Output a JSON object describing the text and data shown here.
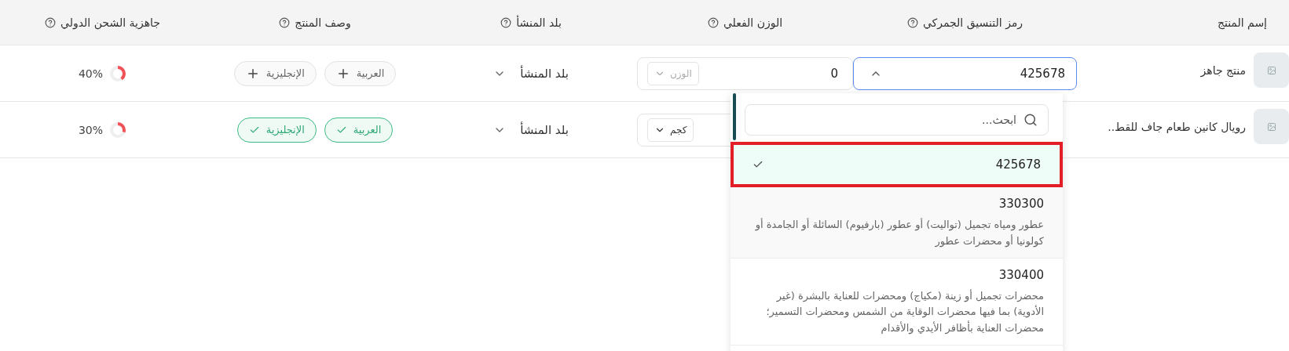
{
  "table": {
    "columns": [
      {
        "label": "إسم المنتج",
        "help": false
      },
      {
        "label": "رمز التنسيق الجمركي",
        "help": true
      },
      {
        "label": "الوزن الفعلي",
        "help": true
      },
      {
        "label": "بلد المنشأ",
        "help": true
      },
      {
        "label": "وصف المنتج",
        "help": true
      },
      {
        "label": "جاهزية الشحن الدولي",
        "help": true
      }
    ],
    "rows": [
      {
        "name": "منتج جاهز",
        "hs_code": {
          "value": "425678",
          "open": true
        },
        "weight": {
          "value": "0",
          "unit_placeholder": "الوزن"
        },
        "origin": "بلد المنشأ",
        "descriptions": [
          {
            "label": "العربية",
            "done": false
          },
          {
            "label": "الإنجليزية",
            "done": false
          }
        ],
        "readiness": {
          "level": 0.4,
          "reading": "40%"
        }
      },
      {
        "name": "رويال كانين طعام جاف للقط..",
        "weight": {
          "unit": "كجم"
        },
        "origin": "بلد المنشأ",
        "descriptions": [
          {
            "label": "العربية",
            "done": true
          },
          {
            "label": "الإنجليزية",
            "done": true
          }
        ],
        "readiness": {
          "level": 0.3,
          "reading": "30%"
        }
      }
    ]
  },
  "hs_dropdown": {
    "search_placeholder": "ابحث...",
    "options": [
      {
        "code": "425678",
        "selected": true
      },
      {
        "code": "330300",
        "description": "عطور ومياه تجميل (تواليت) أو عطور (بارفيوم) السائلة أو الجامدة أو كولونيا أو محضرات عطور",
        "selected": false
      },
      {
        "code": "330400",
        "description": "محضرات تجميل أو زينة (مكياج) ومحضرات للعناية بالبشرة (غير الأدوية) بما فيها محضرات الوقاية من الشمس ومحضرات التسمير؛ محضرات العناية بأظافر الأيدي والأقدام",
        "selected": false
      }
    ]
  }
}
